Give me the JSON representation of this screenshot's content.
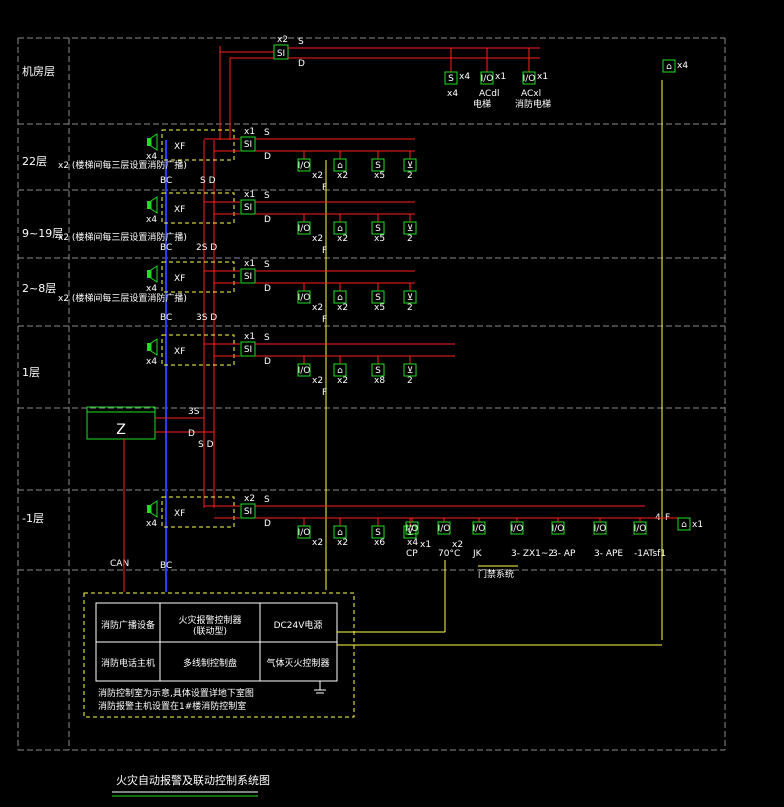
{
  "colors": {
    "background": "#000000",
    "grid": "#8a8a8a",
    "signal_line": "#ff2020",
    "bus_line": "#ffff40",
    "bc_line": "#2e3bff",
    "device": "#22dd22",
    "panel_frame": "#ffff40",
    "text": "#ffffff"
  },
  "floors": [
    {
      "label": "机房层"
    },
    {
      "label": "22层",
      "note": "x2 (楼梯间每三层设置消防广播)",
      "bus": "BC",
      "bus_tags": "S  D"
    },
    {
      "label": "9~19层",
      "note": "x2 (楼梯间每三层设置消防广播)",
      "bus": "BC",
      "bus_tags": "2S  D"
    },
    {
      "label": "2~8层",
      "note": "x2 (楼梯间每三层设置消防广播)",
      "bus": "BC",
      "bus_tags": "3S  D"
    },
    {
      "label": "1层"
    },
    {
      "label": "-1层",
      "bus": "BC",
      "can": "CAN"
    }
  ],
  "module_tag": "XF",
  "si_tag": "SI",
  "s_tag": "S",
  "d_tag": "D",
  "f_tag": "F",
  "speaker_count": "x4",
  "machine_room": {
    "si_count": "x2",
    "devices": [
      {
        "sym": "S",
        "count": "x4",
        "name": ""
      },
      {
        "sym": "I/O",
        "count": "x1",
        "name": "电梯"
      },
      {
        "sym": "I/O",
        "count": "x1",
        "name": "消防电梯"
      }
    ],
    "dev_sub": [
      "",
      "ACdl",
      "ACxl"
    ],
    "right_device": {
      "count": "x4"
    }
  },
  "row_counts": {
    "si": [
      "x1",
      "x1",
      "x1",
      "x1",
      "x2"
    ],
    "io": [
      "x2",
      "x2",
      "x2",
      "x2",
      "x2"
    ],
    "mod": [
      "x2",
      "x2",
      "x2",
      "x2",
      "x2"
    ],
    "smoke": [
      "x5",
      "x5",
      "x5",
      "x8",
      "x6"
    ],
    "z": [
      "2",
      "2",
      "2",
      "2",
      "x4"
    ]
  },
  "basement_extra": [
    {
      "sym": "I/O",
      "label": "CP",
      "count": "x1"
    },
    {
      "sym": "I/O",
      "label": "70°C",
      "count": "x2"
    },
    {
      "sym": "I/O",
      "label": "JK",
      "count": ""
    },
    {
      "sym": "I/O",
      "label": "3- ZX1~2",
      "count": ""
    },
    {
      "sym": "I/O",
      "label": "3- AP",
      "count": ""
    },
    {
      "sym": "I/O",
      "label": "3- APE",
      "count": ""
    },
    {
      "sym": "I/O",
      "label": "-1ATsf1",
      "count": ""
    }
  ],
  "basement_note": "门禁系统",
  "right_side": {
    "wire_count": "4",
    "f": "F",
    "count": "x1"
  },
  "z_box": "Z",
  "z_tags": [
    "3S",
    "D",
    "S  D"
  ],
  "control_panel": {
    "cells": [
      [
        "消防广播设备",
        "火灾报警控制器\n(联动型)",
        "DC24V电源"
      ],
      [
        "消防电话主机",
        "多线制控制盘",
        "气体灭火控制器"
      ]
    ],
    "notes": [
      "消防控制室为示意,具体设置详地下室图",
      "消防报警主机设置在1#楼消防控制室"
    ]
  },
  "title": "火灾自动报警及联动控制系统图"
}
